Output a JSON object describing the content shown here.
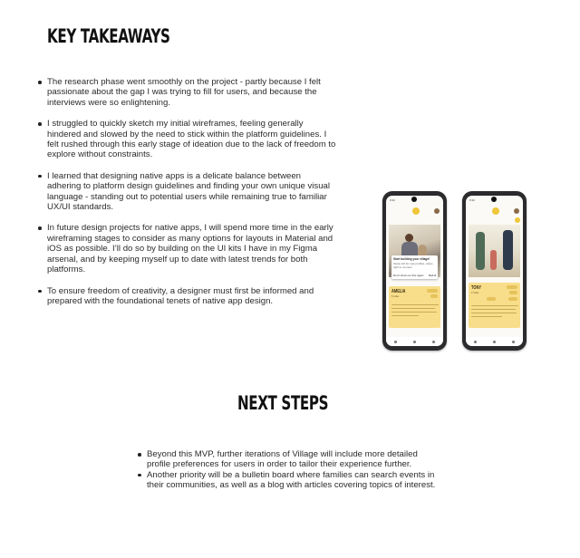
{
  "takeaways": {
    "title": "KEY TAKEAWAYS",
    "items": [
      "The research phase went smoothly on the project - partly because I felt passionate about the gap I was trying to fill for users, and because the interviews were so enlightening.",
      "I struggled to quickly sketch my initial wireframes, feeling generally hindered and slowed by the need to stick within the platform guidelines. I felt rushed through this early stage of ideation due to the lack of freedom to explore without constraints.",
      "I learned that designing native apps is a delicate balance between adhering to platform design guidelines and finding your own unique visual language - standing out to potential users while remaining true to familiar UX/UI standards.",
      "In future design projects for native apps, I will spend more time in the early wireframing stages to consider as many options for layouts in Material and iOS as possible. I’ll do so by building on the UI kits I have in my Figma arsenal, and by keeping myself up to date with latest trends for both platforms.",
      "To ensure freedom of creativity, a designer must first be informed and prepared with the foundational tenets of native app design."
    ]
  },
  "next_steps": {
    "title": "NEXT STEPS",
    "items": [
      "Beyond this MVP, further iterations of Village will include more detailed profile preferences for users in order to tailor their experience further.",
      "Another priority will be a bulletin board where families can search events in their communities, as well as a blog with articles covering topics of interest."
    ]
  },
  "phone_left": {
    "time": "9:30",
    "dialog_title": "Start building your village!",
    "dialog_body": "Swipe left for new profiles, swipe right to connect.",
    "dialog_dismiss": "Don't show me this again",
    "dialog_ok": "Got it",
    "profile_name": "AMELIA",
    "profile_sub": "5 miles"
  },
  "phone_right": {
    "time": "9:30",
    "profile_name": "TONY",
    "profile_sub": "2 miles"
  },
  "colors": {
    "card_yellow": "#f8dd8a",
    "phone_frame": "#2b2b2e",
    "accent": "#f0c63a"
  }
}
